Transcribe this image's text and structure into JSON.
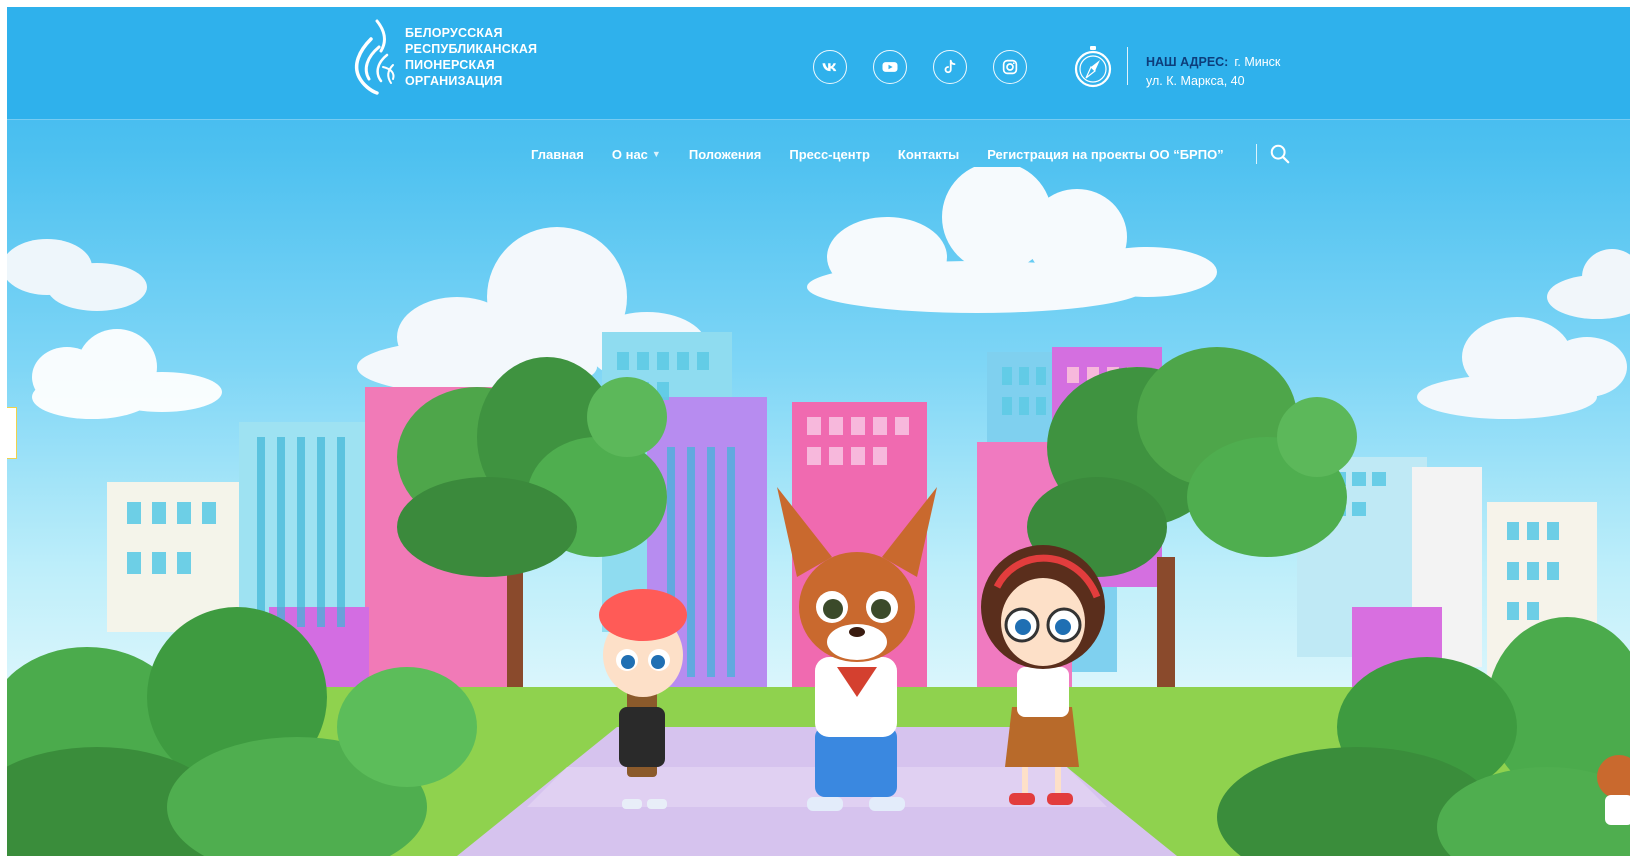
{
  "header": {
    "logo": {
      "line1": "БЕЛОРУССКАЯ",
      "line2": "РЕСПУБЛИКАНСКАЯ",
      "line3": "ПИОНЕРСКАЯ",
      "line4": "ОРГАНИЗАЦИЯ",
      "icon": "flame-logo-icon"
    },
    "socials": [
      {
        "name": "vk",
        "icon": "vk-icon"
      },
      {
        "name": "youtube",
        "icon": "youtube-icon"
      },
      {
        "name": "tiktok",
        "icon": "tiktok-icon"
      },
      {
        "name": "instagram",
        "icon": "instagram-icon"
      }
    ],
    "address": {
      "label": "НАШ АДРЕС:",
      "city": "г. Минск",
      "street": "ул. К. Маркса, 40",
      "icon": "compass-icon"
    }
  },
  "nav": {
    "items": [
      {
        "label": "Главная"
      },
      {
        "label": "О нас",
        "has_dropdown": true
      },
      {
        "label": "Положения"
      },
      {
        "label": "Пресс-центр"
      },
      {
        "label": "Контакты"
      },
      {
        "label": "Регистрация на проекты ОО “БРПО”"
      }
    ],
    "search_icon": "search-icon"
  },
  "hero": {
    "characters": [
      "boy",
      "lynx-mascot",
      "girl"
    ]
  },
  "colors": {
    "header_bg": "#2fb1ec",
    "address_label": "#0d3d7a",
    "text": "#ffffff"
  }
}
